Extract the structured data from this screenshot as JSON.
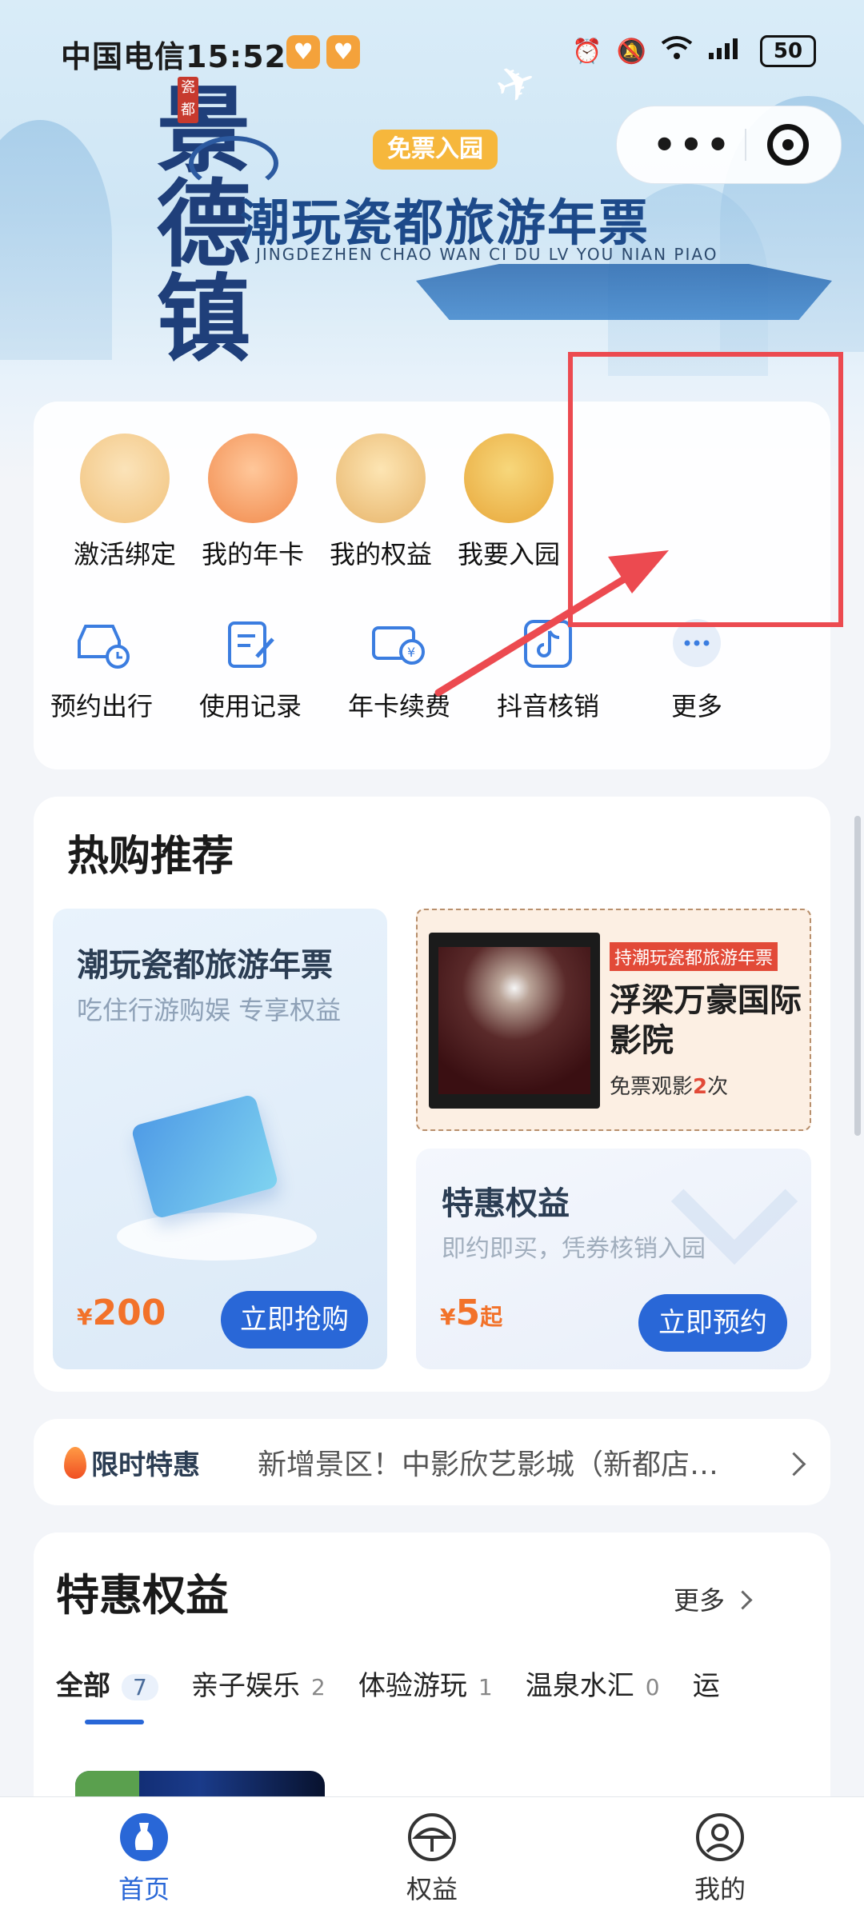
{
  "status_bar": {
    "carrier": "中国电信",
    "time": "15:52",
    "battery": "50"
  },
  "mini_program_capsule": {
    "more_label": "•••"
  },
  "hero": {
    "badge": "免票入园",
    "logo_text": "景德镇",
    "seal_text": "瓷都",
    "title": "潮玩瓷都旅游年票",
    "subtitle": "JINGDEZHEN CHAO WAN CI DU LV YOU NIAN PIAO"
  },
  "quick_menu": {
    "row1": [
      {
        "label": "激活绑定"
      },
      {
        "label": "我的年卡"
      },
      {
        "label": "我的权益"
      },
      {
        "label": "我要入园"
      }
    ],
    "row2": [
      {
        "label": "预约出行"
      },
      {
        "label": "使用记录"
      },
      {
        "label": "年卡续费"
      },
      {
        "label": "抖音核销"
      },
      {
        "label": "更多"
      }
    ]
  },
  "hot_recommend": {
    "title": "热购推荐",
    "annual_ticket": {
      "title": "潮玩瓷都旅游年票",
      "subtitle": "吃住行游购娱 专享权益",
      "price_symbol": "¥",
      "price": "200",
      "button": "立即抢购"
    },
    "cinema": {
      "tag": "持潮玩瓷都旅游年票",
      "title": "浮梁万豪国际影院",
      "sub_prefix": "免票观影",
      "sub_count": "2",
      "sub_suffix": "次"
    },
    "discount": {
      "title": "特惠权益",
      "subtitle": "即约即买，凭券核销入园",
      "price_symbol": "¥",
      "price": "5",
      "price_suffix": "起",
      "button": "立即预约"
    }
  },
  "limited": {
    "logo": "限时特惠",
    "text": "新增景区！中影欣艺影城（新都店…"
  },
  "benefits": {
    "title": "特惠权益",
    "more": "更多",
    "tabs": [
      {
        "label": "全部",
        "count": "7"
      },
      {
        "label": "亲子娱乐",
        "count": "2"
      },
      {
        "label": "体验游玩",
        "count": "1"
      },
      {
        "label": "温泉水汇",
        "count": "0"
      },
      {
        "label": "运",
        "count": ""
      }
    ]
  },
  "tab_bar": {
    "items": [
      {
        "label": "首页"
      },
      {
        "label": "权益"
      },
      {
        "label": "我的"
      }
    ]
  },
  "colors": {
    "primary": "#2967d7",
    "price": "#f2722a",
    "highlight": "#ec4a50"
  }
}
